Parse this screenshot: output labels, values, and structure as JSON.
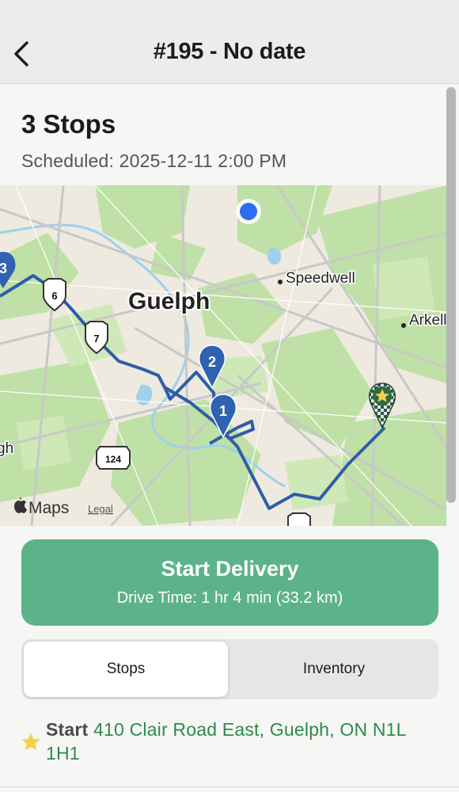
{
  "nav": {
    "title": "#195 - No date",
    "back_icon": "chevron-left-icon"
  },
  "summary": {
    "heading": "3 Stops",
    "scheduled": "Scheduled: 2025-12-11 2:00 PM"
  },
  "map": {
    "places": [
      "Guelph",
      "Speedwell",
      "Arkell"
    ],
    "highway_shields": [
      "6",
      "7",
      "124"
    ],
    "stop_markers": [
      "1",
      "2"
    ],
    "partial_marker": "3",
    "partial_place": "gh",
    "attribution": "Maps",
    "legal_label": "Legal",
    "route_color": "#2e5da8",
    "marker_color": "#2f62b0",
    "start_marker_icon": "star-flag-icon"
  },
  "actions": {
    "start_label": "Start Delivery",
    "drive_time": "Drive Time: 1 hr 4 min (33.2 km)",
    "button_color": "#5cb389"
  },
  "tabs": [
    {
      "label": "Stops",
      "active": true
    },
    {
      "label": "Inventory",
      "active": false
    }
  ],
  "start": {
    "label": "Start",
    "address": "410 Clair Road East, Guelph, ON N1L 1H1",
    "icon": "star-icon"
  }
}
